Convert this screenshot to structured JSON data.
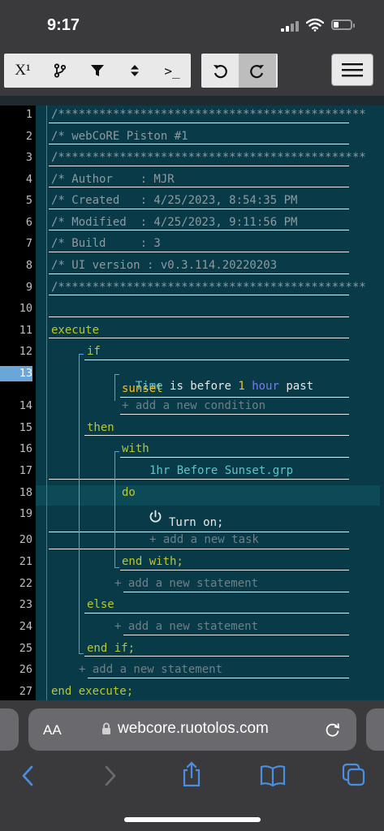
{
  "status": {
    "time": "9:17"
  },
  "toolbar": {
    "superscript_label": "X¹",
    "terminal_label": ">_"
  },
  "editor": {
    "line_numbers": [
      "1",
      "2",
      "3",
      "4",
      "5",
      "6",
      "7",
      "8",
      "9",
      "10",
      "11",
      "12",
      "13",
      "14",
      "15",
      "16",
      "17",
      "18",
      "19",
      "20",
      "21",
      "22",
      "23",
      "24",
      "25",
      "26",
      "27"
    ],
    "selected_line": "13",
    "header": {
      "stars_1": "/*********************************************",
      "title": "/* webCoRE Piston #1",
      "stars_2": "/*********************************************",
      "author": "/* Author    : MJR",
      "created": "/* Created   : 4/25/2023, 8:54:35 PM",
      "modified": "/* Modified  : 4/25/2023, 9:11:56 PM",
      "build": "/* Build     : 3",
      "ui_version": "/* UI version : v0.3.114.20220203",
      "stars_3": "/*********************************************"
    },
    "execute": "execute",
    "if": "if",
    "condition": {
      "left": "Time",
      "op": "is before",
      "value": "1",
      "unit": "hour",
      "rel": "past",
      "target": "sunset"
    },
    "add_condition": "+ add a new condition",
    "then": "then",
    "with": "with",
    "device": "1hr Before Sunset.grp",
    "do": "do",
    "task": "Turn on;",
    "add_task": "+ add a new task",
    "end_with": "end with;",
    "add_statement_then": "+ add a new statement",
    "else": "else",
    "add_statement_else": "+ add a new statement",
    "end_if": "end if;",
    "add_statement_root": "+ add a new statement",
    "end_execute": "end execute;"
  },
  "browser": {
    "text_size_label": "AA",
    "url": "webcore.ruotolos.com"
  },
  "colors": {
    "editor_bg": "#083a48",
    "keyword": "#b8c830",
    "comment": "#8f9aa0",
    "ios_blue": "#4a90e2",
    "selection": "#6aa6d8"
  }
}
